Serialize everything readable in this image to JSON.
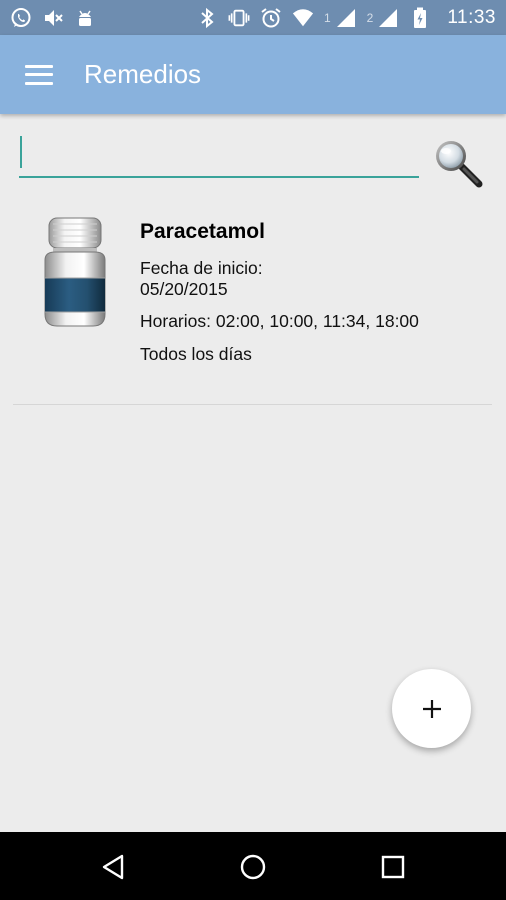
{
  "status_bar": {
    "sim1_label": "1",
    "sim2_label": "2",
    "time": "11:33",
    "icons": [
      "whatsapp-icon",
      "mute-icon",
      "android-icon",
      "bluetooth-icon",
      "vibrate-icon",
      "alarm-icon",
      "wifi-icon",
      "signal-icon",
      "signal-icon",
      "battery-icon"
    ]
  },
  "app_bar": {
    "title": "Remedios"
  },
  "search": {
    "value": "",
    "placeholder": ""
  },
  "medicines": [
    {
      "name": "Paracetamol",
      "start_label": "Fecha de inicio:",
      "start_date": "05/20/2015",
      "schedule": "Horarios: 02:00, 10:00, 11:34, 18:00",
      "frequency": "Todos los días"
    }
  ],
  "colors": {
    "status_bar": "#6e8db0",
    "app_bar": "#89b2dd",
    "accent": "#3aa39a",
    "background": "#ececec"
  }
}
